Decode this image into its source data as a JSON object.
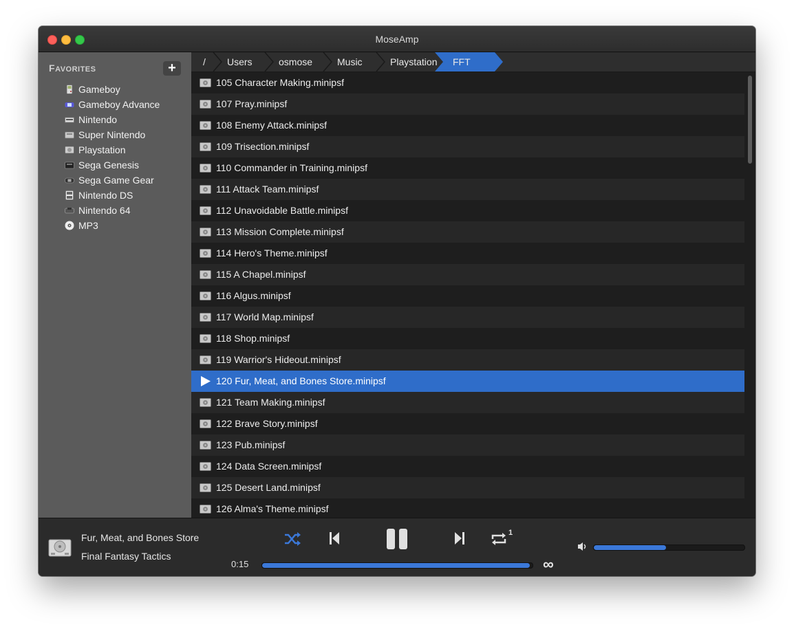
{
  "window": {
    "title": "MoseAmp"
  },
  "sidebar": {
    "header_first": "F",
    "header_rest": "AVORITES",
    "add_label": "+",
    "items": [
      {
        "label": "Gameboy",
        "icon": "gameboy-icon"
      },
      {
        "label": "Gameboy Advance",
        "icon": "gameboy-advance-icon"
      },
      {
        "label": "Nintendo",
        "icon": "nintendo-icon"
      },
      {
        "label": "Super Nintendo",
        "icon": "super-nintendo-icon"
      },
      {
        "label": "Playstation",
        "icon": "playstation-icon"
      },
      {
        "label": "Sega Genesis",
        "icon": "sega-genesis-icon"
      },
      {
        "label": "Sega Game Gear",
        "icon": "game-gear-icon"
      },
      {
        "label": "Nintendo DS",
        "icon": "nintendo-ds-icon"
      },
      {
        "label": "Nintendo 64",
        "icon": "nintendo-64-icon"
      },
      {
        "label": "MP3",
        "icon": "disc-icon"
      }
    ]
  },
  "breadcrumb": [
    "/",
    "Users",
    "osmose",
    "Music",
    "Playstation",
    "FFT"
  ],
  "files": [
    "105 Character Making.minipsf",
    "107 Pray.minipsf",
    "108 Enemy Attack.minipsf",
    "109 Trisection.minipsf",
    "110 Commander in Training.minipsf",
    "111 Attack Team.minipsf",
    "112 Unavoidable Battle.minipsf",
    "113 Mission Complete.minipsf",
    "114 Hero's Theme.minipsf",
    "115 A Chapel.minipsf",
    "116 Algus.minipsf",
    "117 World Map.minipsf",
    "118 Shop.minipsf",
    "119 Warrior's Hideout.minipsf",
    "120 Fur, Meat, and Bones Store.minipsf",
    "121 Team Making.minipsf",
    "122 Brave Story.minipsf",
    "123 Pub.minipsf",
    "124 Data Screen.minipsf",
    "125 Desert Land.minipsf",
    "126 Alma's Theme.minipsf"
  ],
  "selected_index": 14,
  "player": {
    "track_title": "Fur, Meat, and Bones Store",
    "album": "Final Fantasy Tactics",
    "elapsed": "0:15",
    "duration_symbol": "∞",
    "progress": 0.99,
    "repeat_count": "1",
    "volume": 0.48
  },
  "colors": {
    "accent": "#2f6dc9",
    "sidebar_bg": "#5b5b5b",
    "list_bg": "#1e1e1e"
  }
}
